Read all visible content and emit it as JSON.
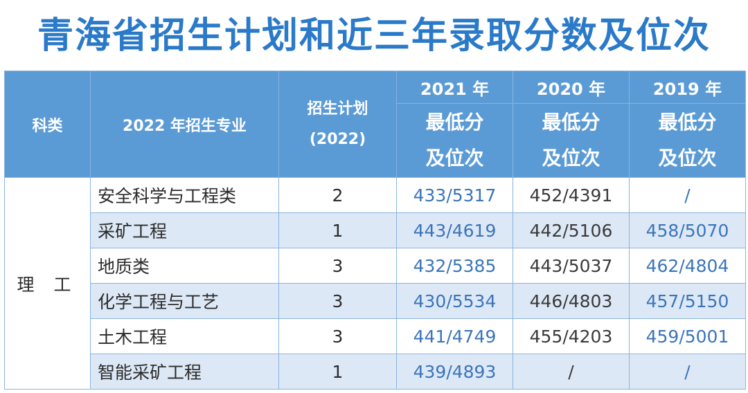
{
  "title": "青海省招生计划和近三年录取分数及位次",
  "header": {
    "category": "科类",
    "major": "2022 年招生专业",
    "plan_line1": "招生计划",
    "plan_line2": "(2022)",
    "years": [
      "2021 年",
      "2020 年",
      "2019 年"
    ],
    "score_line1": "最低分",
    "score_line2": "及位次"
  },
  "category_label": "理 工",
  "rows": [
    {
      "major": "安全科学与工程类",
      "plan": "2",
      "y2021": "433/5317",
      "y2020": "452/4391",
      "y2019": "/"
    },
    {
      "major": "采矿工程",
      "plan": "1",
      "y2021": "443/4619",
      "y2020": "442/5106",
      "y2019": "458/5070"
    },
    {
      "major": "地质类",
      "plan": "3",
      "y2021": "432/5385",
      "y2020": "443/5037",
      "y2019": "462/4804"
    },
    {
      "major": "化学工程与工艺",
      "plan": "3",
      "y2021": "430/5534",
      "y2020": "446/4803",
      "y2019": "457/5150"
    },
    {
      "major": "土木工程",
      "plan": "3",
      "y2021": "441/4749",
      "y2020": "455/4203",
      "y2019": "459/5001"
    },
    {
      "major": "智能采矿工程",
      "plan": "1",
      "y2021": "439/4893",
      "y2020": "/",
      "y2019": "/"
    }
  ],
  "colors": {
    "title": "#2a7ac9",
    "header_bg": "#5b9bd5",
    "row_alt_bg": "#dde8f6",
    "score_blue": "#3a74ba"
  }
}
